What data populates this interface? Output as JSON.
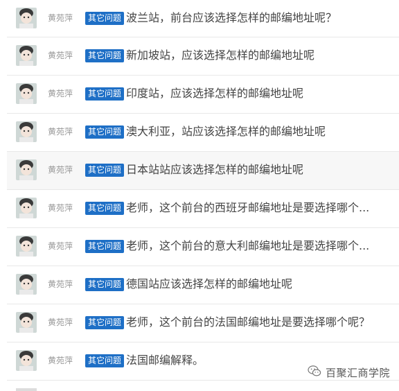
{
  "list": {
    "items": [
      {
        "author": "黄苑萍",
        "tag": "其它问题",
        "title": "波兰站，前台应该选择怎样的邮编地址呢？"
      },
      {
        "author": "黄苑萍",
        "tag": "其它问题",
        "title": "新加坡站，应该选择怎样的邮编地址呢"
      },
      {
        "author": "黄苑萍",
        "tag": "其它问题",
        "title": "印度站，应该选择怎样的邮编地址呢"
      },
      {
        "author": "黄苑萍",
        "tag": "其它问题",
        "title": "澳大利亚，站应该选择怎样的邮编地址呢"
      },
      {
        "author": "黄苑萍",
        "tag": "其它问题",
        "title": "日本站站应该选择怎样的邮编地址呢"
      },
      {
        "author": "黄苑萍",
        "tag": "其它问题",
        "title": "老师，这个前台的西班牙邮编地址是要选择哪个..."
      },
      {
        "author": "黄苑萍",
        "tag": "其它问题",
        "title": "老师，这个前台的意大利邮编地址是要选择哪个..."
      },
      {
        "author": "黄苑萍",
        "tag": "其它问题",
        "title": "德国站应该选择怎样的邮编地址呢"
      },
      {
        "author": "黄苑萍",
        "tag": "其它问题",
        "title": "老师，这个前台的法国邮编地址是要选择哪个呢？"
      },
      {
        "author": "黄苑萍",
        "tag": "其它问题",
        "title": "法国邮编解释。"
      }
    ]
  },
  "watermark": {
    "text": "百聚汇商学院",
    "icon": "wechat-icon"
  },
  "colors": {
    "badge": "#1e6fc6",
    "author": "#999999",
    "title": "#444444",
    "divider": "#e8e8e8",
    "highlight_row": "#f7f7f7"
  }
}
